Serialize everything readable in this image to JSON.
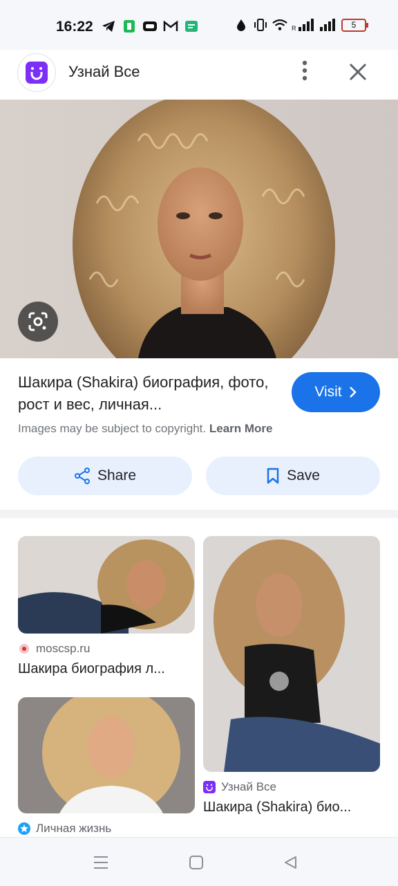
{
  "status_bar": {
    "time": "16:22",
    "battery_level": "5",
    "left_icons": [
      "telegram-icon",
      "phone-app-icon",
      "tv-icon",
      "gmail-icon",
      "message-icon"
    ],
    "right_icons": [
      "water-drop-icon",
      "vibrate-icon",
      "wifi-icon",
      "signal-icon",
      "signal-icon",
      "battery-icon"
    ]
  },
  "app_header": {
    "title": "Узнай Все",
    "logo_icon": "smile-u-logo",
    "more_icon": "more-vert-icon",
    "close_icon": "close-icon"
  },
  "hero": {
    "lens_icon": "google-lens-icon"
  },
  "result": {
    "title": "Шакира (Shakira) биография, фото, рост и вес, личная...",
    "visit_label": "Visit",
    "copyright_text": "Images may be subject to copyright.",
    "learn_more": "Learn More",
    "share_label": "Share",
    "save_label": "Save"
  },
  "related": [
    {
      "source": "moscsp.ru",
      "caption": "Шакира биография л..."
    },
    {
      "source": "Узнай Все",
      "caption": "Шакира (Shakira) био..."
    },
    {
      "source": "Личная жизнь",
      "caption": ""
    }
  ],
  "colors": {
    "accent": "#1a73e8",
    "pill_bg": "#e8f0fe",
    "brand_purple": "#7b2ff7"
  }
}
